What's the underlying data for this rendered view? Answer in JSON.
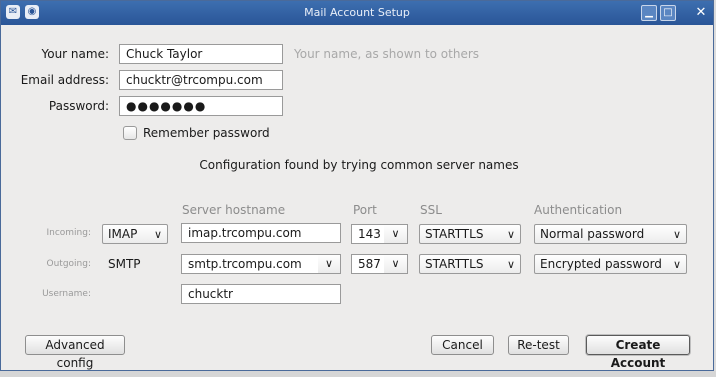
{
  "window": {
    "title": "Mail Account Setup"
  },
  "titlebar": {
    "app_icon": "thunderbird-icon",
    "menu_icon": "window-menu-icon",
    "minimize_glyph": "▁",
    "maximize_glyph": "□",
    "close_glyph": "✕"
  },
  "form": {
    "name_label": "Your name:",
    "name_value": "Chuck Taylor",
    "name_hint": "Your name, as shown to others",
    "email_label": "Email address:",
    "email_value": "chucktr@trcompu.com",
    "password_label": "Password:",
    "password_value": "●●●●●●●",
    "remember_label": "Remember password",
    "remember_checked": false
  },
  "status": "Configuration found by trying common server names",
  "servers": {
    "headers": {
      "hostname": "Server hostname",
      "port": "Port",
      "ssl": "SSL",
      "auth": "Authentication"
    },
    "incoming": {
      "label": "Incoming:",
      "protocol": "IMAP",
      "hostname": "imap.trcompu.com",
      "port": "143",
      "ssl": "STARTTLS",
      "auth": "Normal password"
    },
    "outgoing": {
      "label": "Outgoing:",
      "protocol": "SMTP",
      "hostname": "smtp.trcompu.com",
      "port": "587",
      "ssl": "STARTTLS",
      "auth": "Encrypted password"
    },
    "username": {
      "label": "Username:",
      "value": "chucktr"
    }
  },
  "buttons": {
    "advanced": "Advanced config",
    "cancel": "Cancel",
    "retest": "Re-test",
    "create": "Create Account"
  },
  "chevron_glyph": "∨"
}
